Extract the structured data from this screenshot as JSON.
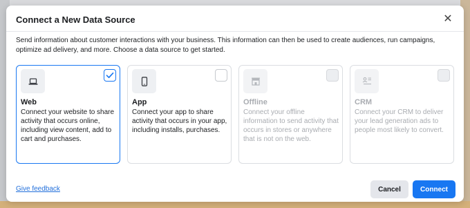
{
  "dialog": {
    "title": "Connect a New Data Source",
    "close_symbol": "✕",
    "description": "Send information about customer interactions with your business. This information can then be used to create audiences, run campaigns, optimize ad delivery, and more. Choose a data source to get started."
  },
  "sources": [
    {
      "icon": "laptop-icon",
      "title": "Web",
      "body": "Connect your website to share activity that occurs online, including view content, add to cart and purchases.",
      "selected": true,
      "enabled": true
    },
    {
      "icon": "phone-icon",
      "title": "App",
      "body": "Connect your app to share activity that occurs in your app, including installs, purchases.",
      "selected": false,
      "enabled": true
    },
    {
      "icon": "store-icon",
      "title": "Offline",
      "body": "Connect your offline information to send activity that occurs in stores or anywhere that is not on the web.",
      "selected": false,
      "enabled": false
    },
    {
      "icon": "crm-icon",
      "title": "CRM",
      "body": "Connect your CRM to deliver your lead generation ads to people most likely to convert.",
      "selected": false,
      "enabled": false
    }
  ],
  "footer": {
    "feedback_link": "Give feedback",
    "cancel_label": "Cancel",
    "connect_label": "Connect"
  },
  "colors": {
    "accent": "#1877f2",
    "disabled_text": "#a9acb1"
  }
}
